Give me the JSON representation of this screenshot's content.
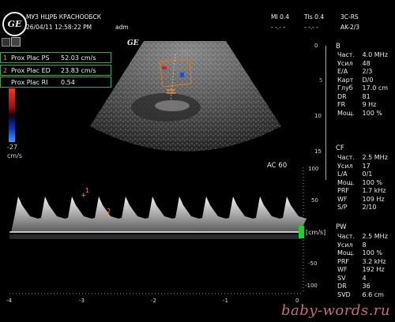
{
  "header": {
    "clinic": "МУЗ НЦРБ КРАСНООБСК",
    "datetime": "26/04/11 12:58:22 PM",
    "operator": "adm",
    "mi": "MI 0.4",
    "tis": "TIs 0.4",
    "probe": "3C-RS",
    "preset": "AK-2/3",
    "dashes1": "- -.- -",
    "dashes2": "- -.- -"
  },
  "logo": {
    "text": "GE",
    "small_text": "GE"
  },
  "measurements": [
    {
      "num": "1",
      "label": "Prox Plac PS",
      "value": "52.03 cm/s"
    },
    {
      "num": "2",
      "label": "Prox Plac ED",
      "value": "23.83 cm/s"
    },
    {
      "num": "",
      "label": "Prox Plac RI",
      "value": "0.54"
    }
  ],
  "color_scale": {
    "value": "-27",
    "unit": "cm/s"
  },
  "depth_ticks": [
    "0",
    "5",
    "10",
    "15"
  ],
  "b_mode": {
    "title": "B",
    "rows": [
      {
        "k": "Част.",
        "v": "4.0 MHz"
      },
      {
        "k": "Усил",
        "v": "48"
      },
      {
        "k": "E/A",
        "v": "2/3"
      },
      {
        "k": "Карт",
        "v": "D/0"
      },
      {
        "k": "Глуб",
        "v": "17.0 cm"
      },
      {
        "k": "DR",
        "v": "81"
      },
      {
        "k": "FR",
        "v": "9 Hz"
      },
      {
        "k": "Мощ.",
        "v": "100 %"
      }
    ]
  },
  "cf_mode": {
    "title": "CF",
    "rows": [
      {
        "k": "Част.",
        "v": "2.5 MHz"
      },
      {
        "k": "Усил",
        "v": "17"
      },
      {
        "k": "L/A",
        "v": "0/1"
      },
      {
        "k": "Мощ.",
        "v": "100 %"
      },
      {
        "k": "PRF",
        "v": "1.7 kHz"
      },
      {
        "k": "WF",
        "v": "109 Hz"
      },
      {
        "k": "S/P",
        "v": "2/10"
      }
    ]
  },
  "pw_mode": {
    "title": "PW",
    "rows": [
      {
        "k": "Част.",
        "v": "2.5 MHz"
      },
      {
        "k": "Усил",
        "v": "8"
      },
      {
        "k": "Мощ.",
        "v": "100 %"
      },
      {
        "k": "PRF",
        "v": "3.2 kHz"
      },
      {
        "k": "WF",
        "v": "192 Hz"
      },
      {
        "k": "SV",
        "v": "4"
      },
      {
        "k": "DR",
        "v": "36"
      },
      {
        "k": "SVD",
        "v": "6.6 cm"
      }
    ]
  },
  "doppler": {
    "angle_label": "AC 60",
    "unit_label": "[cm/s]",
    "velocity_ticks": [
      "100",
      "50",
      "-50",
      "-100"
    ],
    "time_ticks": [
      "-4",
      "-3",
      "-2",
      "-1",
      "0"
    ]
  },
  "watermark": "baby-words.ru",
  "colors": {
    "measure_border": "#2ea84a",
    "marker": "#ff8a2a",
    "watermark": "#c86a86"
  }
}
